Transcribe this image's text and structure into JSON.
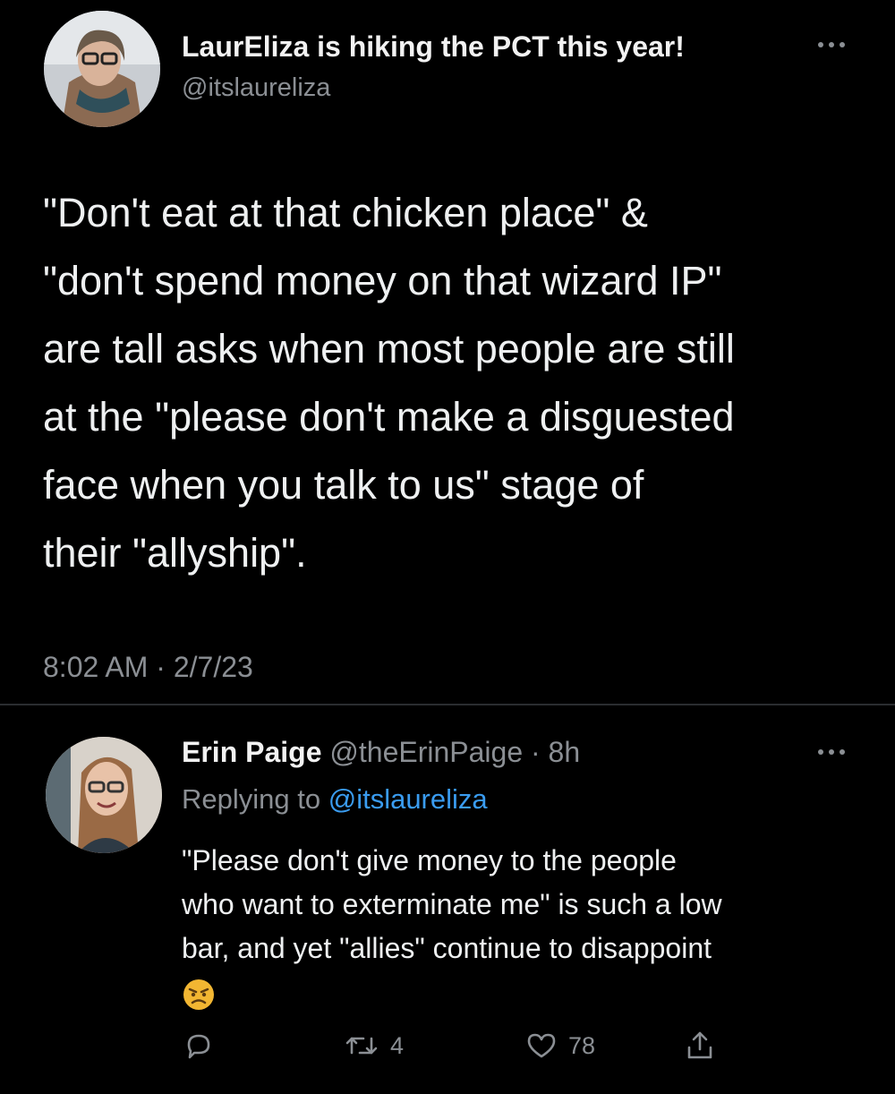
{
  "tweet": {
    "display_name": "LaurEliza is hiking the PCT this year!",
    "handle": "@itslaureliza",
    "text": "\"Don't eat at that chicken place\" &\n\"don't spend money on that wizard IP\"\nare tall asks when most people are still\nat the \"please don't make a disguested\nface when you talk to us\" stage of\ntheir \"allyship\".",
    "timestamp": "8:02 AM · 2/7/23"
  },
  "reply": {
    "display_name": "Erin Paige",
    "meta": " @theErinPaige · 8h",
    "replying_prefix": "Replying to ",
    "replying_handle": "@itslaureliza",
    "text": "\"Please don't give money to the people\nwho want to exterminate me\" is such a low\nbar, and yet \"allies\" continue to disappoint",
    "actions": {
      "retweet_count": "4",
      "like_count": "78"
    }
  },
  "colors": {
    "background": "#000000",
    "secondary_text": "#8b8f94",
    "link": "#3a9cf0"
  },
  "icons": [
    "more-icon",
    "reply-icon",
    "retweet-icon",
    "like-icon",
    "share-icon",
    "angry-face-emoji"
  ]
}
